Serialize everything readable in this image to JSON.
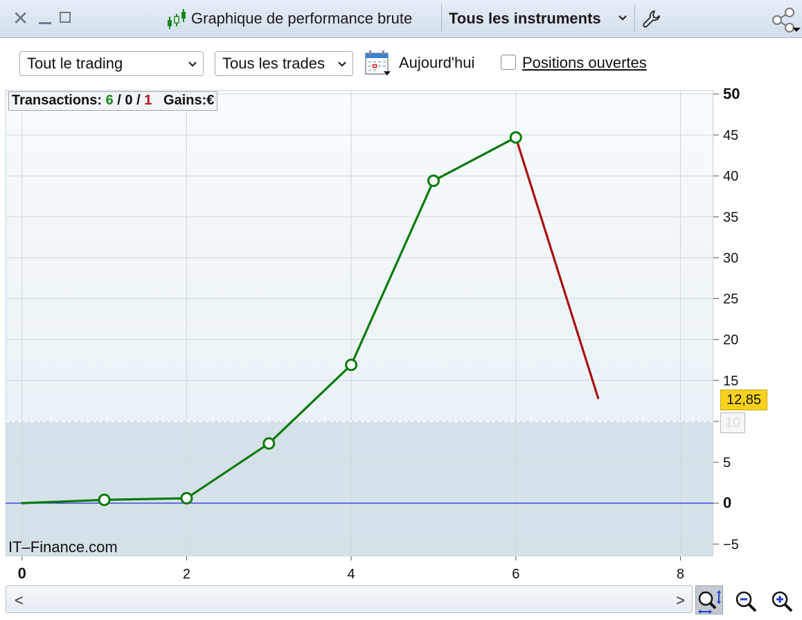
{
  "titlebar": {
    "title": "Graphique de performance brute",
    "instruments": "Tous les instruments",
    "icons": [
      "close-icon",
      "minimize-icon",
      "maximize-icon",
      "candlestick-icon",
      "chevron-down-icon",
      "wrench-icon",
      "share-icon"
    ]
  },
  "toolbar": {
    "trading_select": "Tout le trading",
    "trades_select": "Tous les trades",
    "today_label": "Aujourd'hui",
    "open_positions_label": "Positions ouvertes",
    "open_positions_checked": false
  },
  "stats": {
    "transactions_label": "Transactions:",
    "wins": "6",
    "sep1": "/",
    "neutral": "0",
    "sep2": "/",
    "losses": "1",
    "gains_label": "Gains:",
    "currency": "€"
  },
  "watermark": "IT–Finance.com",
  "price_tag": "12,85",
  "level_tag": "10",
  "scroll": {
    "left": "<",
    "right": ">"
  },
  "colors": {
    "up": "#0a7a0a",
    "down": "#a80e0e",
    "zero_line": "#1f2fd0",
    "price_tag": "#f6d21d"
  },
  "chart_data": {
    "type": "line",
    "x": [
      0,
      1,
      2,
      3,
      4,
      5,
      6,
      7
    ],
    "y": [
      0,
      0.4,
      0.6,
      7.3,
      16.9,
      39.4,
      44.7,
      12.85
    ],
    "point_markers": [
      false,
      true,
      true,
      true,
      true,
      true,
      true,
      false
    ],
    "segment_colors": [
      "up",
      "up",
      "up",
      "up",
      "up",
      "up",
      "down"
    ],
    "xlim": [
      -0.2,
      8.4
    ],
    "ylim": [
      -6.5,
      50.5
    ],
    "x_ticks": [
      0,
      2,
      4,
      6,
      8
    ],
    "x_tick_labels": [
      "0",
      "2",
      "4",
      "6",
      "8"
    ],
    "y_ticks": [
      50,
      45,
      40,
      35,
      30,
      25,
      20,
      15,
      10,
      5,
      0,
      -5
    ],
    "y_tick_labels": [
      "50",
      "45",
      "40",
      "35",
      "30",
      "25",
      "20",
      "15",
      "",
      "5",
      "0",
      "−5"
    ],
    "reference_line": 10,
    "zero_line": 0,
    "grid": true
  }
}
